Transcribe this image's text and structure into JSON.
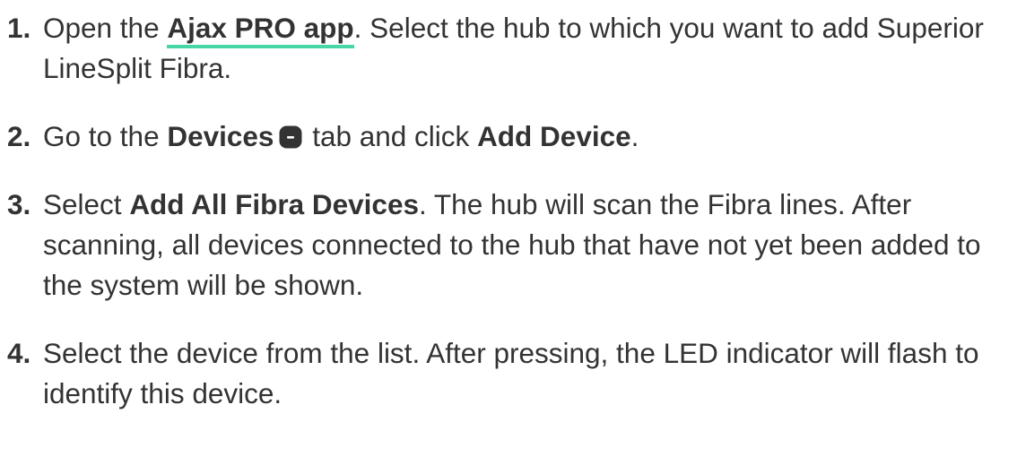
{
  "steps": [
    {
      "number": "1.",
      "t1": "Open the ",
      "link": "Ajax PRO app",
      "t2": ". Select the hub to which you want to add Superior LineSplit Fibra."
    },
    {
      "number": "2.",
      "t1": "Go to the ",
      "b1": "Devices",
      "icon": "devices-tab-icon",
      "t2": " tab and click ",
      "b2": "Add Device",
      "t3": "."
    },
    {
      "number": "3.",
      "t1": "Select ",
      "b1": "Add All Fibra Devices",
      "t2": ". The hub will scan the Fibra lines. After scanning, all devices connected to the hub that have not yet been added to the system will be shown."
    },
    {
      "number": "4.",
      "t1": "Select the device from the list. After pressing, the LED indicator will flash to identify this device."
    }
  ],
  "colors": {
    "text": "#333333",
    "link_underline": "#46d6a8",
    "icon_fill": "#333333"
  }
}
